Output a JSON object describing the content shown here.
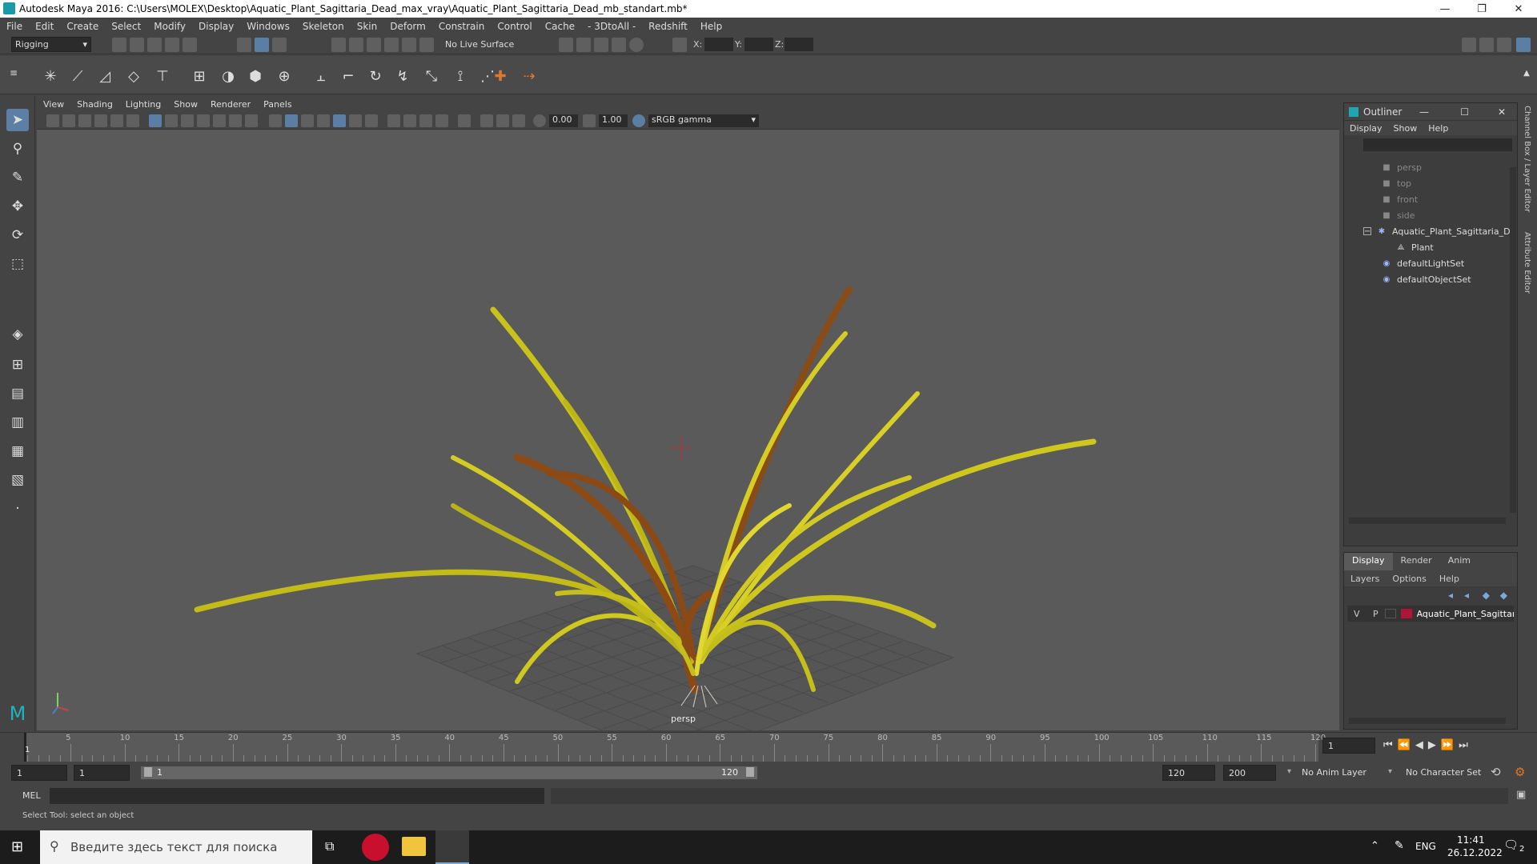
{
  "titlebar": {
    "title": "Autodesk Maya 2016: C:\\Users\\MOLEX\\Desktop\\Aquatic_Plant_Sagittaria_Dead_max_vray\\Aquatic_Plant_Sagittaria_Dead_mb_standart.mb*"
  },
  "menubar": {
    "items": [
      "File",
      "Edit",
      "Create",
      "Select",
      "Modify",
      "Display",
      "Windows",
      "Skeleton",
      "Skin",
      "Deform",
      "Constrain",
      "Control",
      "Cache",
      "- 3DtoAll -",
      "Redshift",
      "Help"
    ]
  },
  "statusline": {
    "mode": "Rigging",
    "live_surface": "No Live Surface",
    "x_label": "X:",
    "y_label": "Y:",
    "z_label": "Z:"
  },
  "viewport": {
    "menu": [
      "View",
      "Shading",
      "Lighting",
      "Show",
      "Renderer",
      "Panels"
    ],
    "exposure": "0.00",
    "gamma": "1.00",
    "colorspace": "sRGB gamma",
    "camera_label": "persp"
  },
  "outliner": {
    "title": "Outliner",
    "menu": [
      "Display",
      "Show",
      "Help"
    ],
    "items": [
      {
        "label": "persp",
        "dim": true
      },
      {
        "label": "top",
        "dim": true
      },
      {
        "label": "front",
        "dim": true
      },
      {
        "label": "side",
        "dim": true
      },
      {
        "label": "Aquatic_Plant_Sagittaria_D",
        "dim": false
      },
      {
        "label": "Plant",
        "dim": false
      },
      {
        "label": "defaultLightSet",
        "dim": false
      },
      {
        "label": "defaultObjectSet",
        "dim": false
      }
    ]
  },
  "layers": {
    "tabs": [
      "Display",
      "Render",
      "Anim"
    ],
    "menu": [
      "Layers",
      "Options",
      "Help"
    ],
    "layer_v": "V",
    "layer_p": "P",
    "layer_name": "Aquatic_Plant_Sagittar",
    "layer_color": "#b0143a"
  },
  "siderail": {
    "channel_box": "Channel Box / Layer Editor",
    "attribute_editor": "Attribute Editor"
  },
  "timeline": {
    "ticks": [
      "5",
      "10",
      "15",
      "20",
      "25",
      "30",
      "35",
      "40",
      "45",
      "50",
      "55",
      "60",
      "65",
      "70",
      "75",
      "80",
      "85",
      "90",
      "95",
      "100",
      "105",
      "110",
      "115",
      "120"
    ],
    "current_marker": "1",
    "current_frame": "1"
  },
  "range": {
    "start": "1",
    "playback_start": "1",
    "slider_start": "1",
    "slider_end": "120",
    "playback_end": "120",
    "end": "200",
    "anim_layer": "No Anim Layer",
    "char_set": "No Character Set"
  },
  "cmd": {
    "label": "MEL"
  },
  "help": {
    "text": "Select Tool: select an object"
  },
  "taskbar": {
    "search_placeholder": "Введите здесь текст для поиска",
    "lang": "ENG",
    "time": "11:41",
    "date": "26.12.2022",
    "notif_count": "2"
  }
}
